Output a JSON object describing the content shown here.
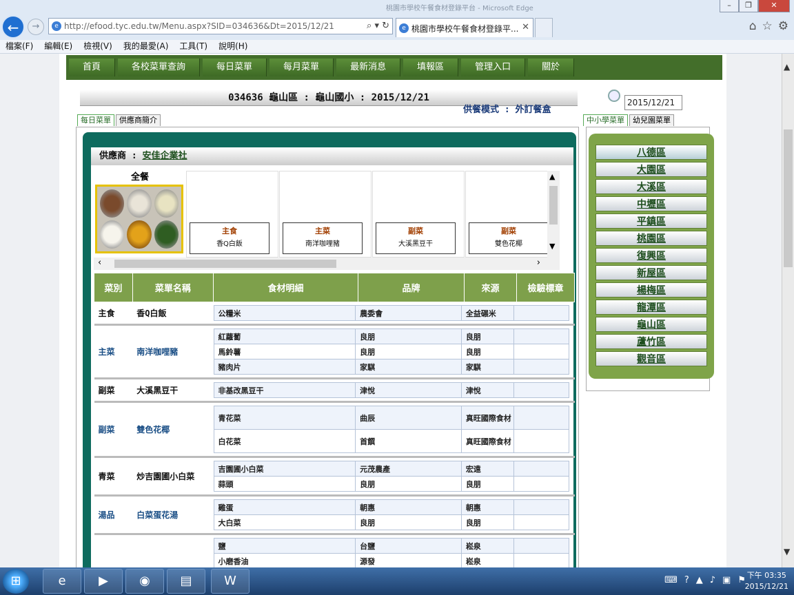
{
  "browser": {
    "window_title": "桃園市學校午餐食材登錄平台 - Microsoft Edge",
    "url": "http://efood.tyc.edu.tw/Menu.aspx?SID=034636&Dt=2015/12/21",
    "tab_title": "桃園市學校午餐食材登錄平...",
    "menu": [
      "檔案(F)",
      "編輯(E)",
      "檢視(V)",
      "我的最愛(A)",
      "工具(T)",
      "說明(H)"
    ]
  },
  "nav": [
    "首頁",
    "各校菜單查詢",
    "每日菜單",
    "每月菜單",
    "最新消息",
    "填報區",
    "管理入口",
    "關於"
  ],
  "header": {
    "title": "034636 龜山區 : 龜山國小 : 2015/12/21",
    "mode": "供餐模式 : 外訂餐盒",
    "date": "2015/12/21"
  },
  "left_tabs": [
    "每日菜單",
    "供應商簡介"
  ],
  "right_tabs": [
    "中小學菜單",
    "幼兒園菜單"
  ],
  "supplier": {
    "label": "供應商 :",
    "name": "安佳企業社"
  },
  "photo_label": "全餐",
  "dishes": [
    {
      "cat": "主食",
      "name": "香Q白飯"
    },
    {
      "cat": "主菜",
      "name": "南洋咖哩豬"
    },
    {
      "cat": "副菜",
      "name": "大溪黑豆干"
    },
    {
      "cat": "副菜",
      "name": "雙色花椰"
    }
  ],
  "table": {
    "headers": [
      "菜別",
      "菜單名稱",
      "食材明細",
      "品牌",
      "來源",
      "檢驗標章"
    ],
    "rows": [
      {
        "cat": "主食",
        "dish": "香Q白飯",
        "items": [
          [
            "公糧米",
            "農委會",
            "全益碾米",
            ""
          ]
        ]
      },
      {
        "cat": "主菜",
        "dish": "南洋咖哩豬",
        "items": [
          [
            "紅蘿蔔",
            "良朋",
            "良朋",
            ""
          ],
          [
            "馬鈴薯",
            "良朋",
            "良朋",
            ""
          ],
          [
            "豬肉片",
            "家騏",
            "家騏",
            ""
          ]
        ]
      },
      {
        "cat": "副菜",
        "dish": "大溪黑豆干",
        "items": [
          [
            "非基改黑豆干",
            "津悅",
            "津悅",
            ""
          ]
        ]
      },
      {
        "cat": "副菜",
        "dish": "雙色花椰",
        "items": [
          [
            "青花菜",
            "曲辰",
            "真旺國際食材",
            ""
          ],
          [
            "白花菜",
            "首饌",
            "真旺國際食材",
            ""
          ]
        ]
      },
      {
        "cat": "青菜",
        "dish": "炒吉園圃小白菜",
        "items": [
          [
            "吉園圃小白菜",
            "元茂農產",
            "宏遠",
            ""
          ],
          [
            "蒜頭",
            "良朋",
            "良朋",
            ""
          ]
        ]
      },
      {
        "cat": "湯品",
        "dish": "白菜蛋花湯",
        "items": [
          [
            "雞蛋",
            "朝惠",
            "朝惠",
            ""
          ],
          [
            "大白菜",
            "良朋",
            "良朋",
            ""
          ]
        ]
      },
      {
        "cat": "",
        "dish": "",
        "items": [
          [
            "鹽",
            "台鹽",
            "崧泉",
            ""
          ],
          [
            "小磨香油",
            "源發",
            "崧泉",
            ""
          ]
        ]
      }
    ]
  },
  "districts": [
    "八德區",
    "大園區",
    "大溪區",
    "中壢區",
    "平鎮區",
    "桃園區",
    "復興區",
    "新屋區",
    "楊梅區",
    "龍潭區",
    "龜山區",
    "蘆竹區",
    "觀音區"
  ],
  "taskbar": {
    "time": "下午 03:35",
    "date": "2015/12/21"
  }
}
